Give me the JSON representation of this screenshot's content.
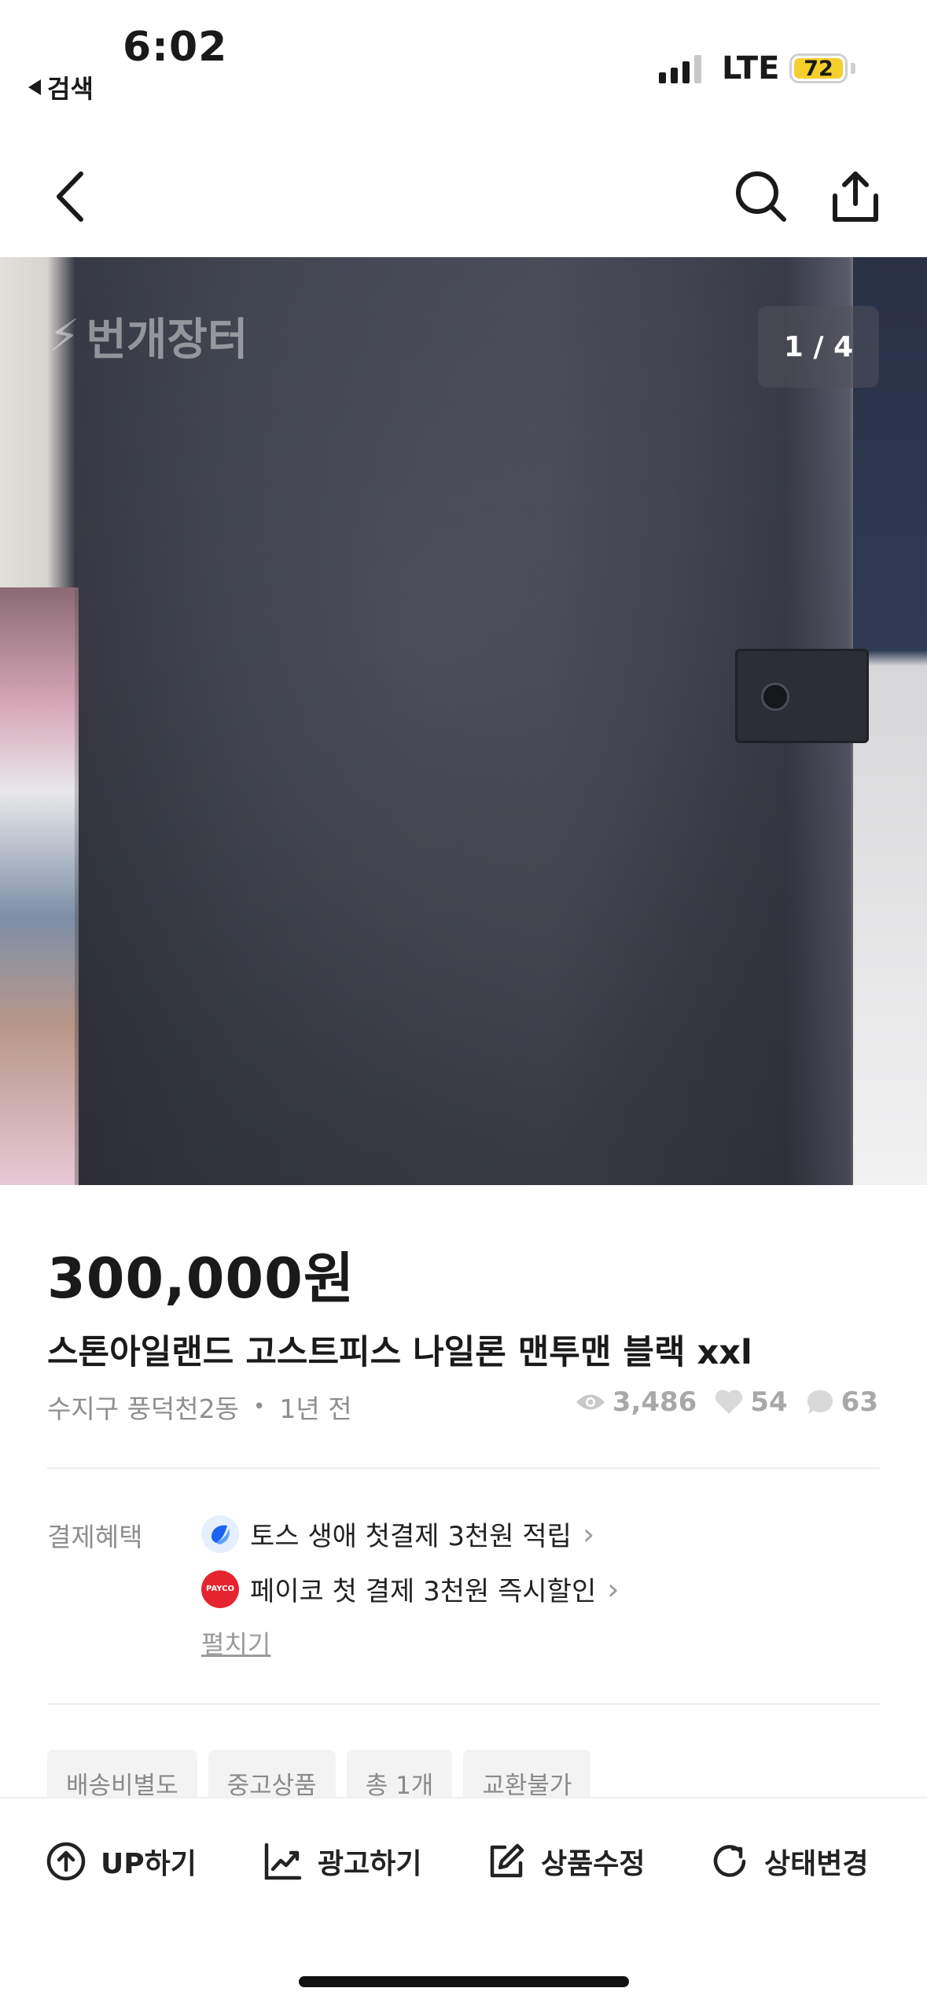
{
  "status_bar": {
    "time": "6:02",
    "back_app": "검색",
    "network": "LTE",
    "battery": "72",
    "battery_color": "#f5cf2b"
  },
  "nav": {
    "back_icon": "chevron-left-icon",
    "search_icon": "search-icon",
    "share_icon": "share-icon"
  },
  "gallery": {
    "watermark": "번개장터",
    "counter": "1 / 4"
  },
  "product": {
    "price": "300,000원",
    "title": "스톤아일랜드 고스트피스 나일론 맨투맨 블랙 xxl",
    "location": "수지구 풍덕천2동",
    "time_ago": "1년 전",
    "views": "3,486",
    "likes": "54",
    "chats": "63"
  },
  "payment": {
    "label": "결제혜택",
    "benefits": [
      {
        "text": "토스 생애 첫결제 3천원 적립",
        "logo": "toss-icon"
      },
      {
        "text": "페이코 첫 결제 3천원 즉시할인",
        "logo": "payco-icon",
        "logo_text": "PAYCO"
      }
    ],
    "expand": "펼치기"
  },
  "tags": [
    "배송비별도",
    "중고상품",
    "총 1개",
    "교환불가"
  ],
  "toolbar": {
    "up": "UP하기",
    "ad": "광고하기",
    "edit": "상품수정",
    "status": "상태변경"
  }
}
